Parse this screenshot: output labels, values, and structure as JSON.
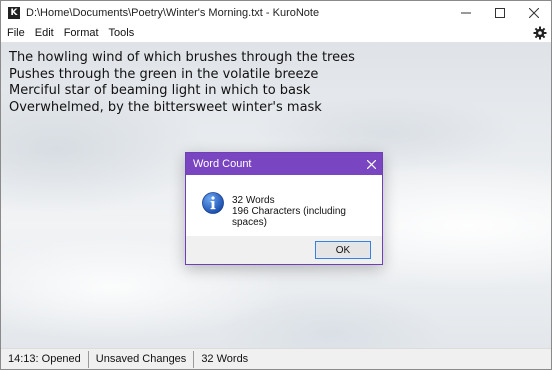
{
  "window": {
    "title": "D:\\Home\\Documents\\Poetry\\Winter's Morning.txt - KuroNote",
    "app_icon_letter": "K",
    "controls": {
      "minimize": "—",
      "maximize": "☐",
      "close": "✕"
    }
  },
  "menu": {
    "items": [
      {
        "label": "File"
      },
      {
        "label": "Edit"
      },
      {
        "label": "Format"
      },
      {
        "label": "Tools"
      }
    ],
    "settings_icon": "gear-icon"
  },
  "editor": {
    "lines": [
      "The howling wind of which brushes through the trees",
      "Pushes through the green in the volatile breeze",
      "Merciful star of beaming light in which to bask",
      "Overwhelmed, by the bittersweet winter's mask"
    ]
  },
  "status": {
    "time_event": "14:13: Opened",
    "save_state": "Unsaved Changes",
    "word_count": "32 Words"
  },
  "dialog": {
    "title": "Word Count",
    "close": "✕",
    "icon": "info-icon",
    "words": "32 Words",
    "characters": "196 Characters (including spaces)",
    "ok_label": "OK",
    "accent": "#7a45c0"
  }
}
